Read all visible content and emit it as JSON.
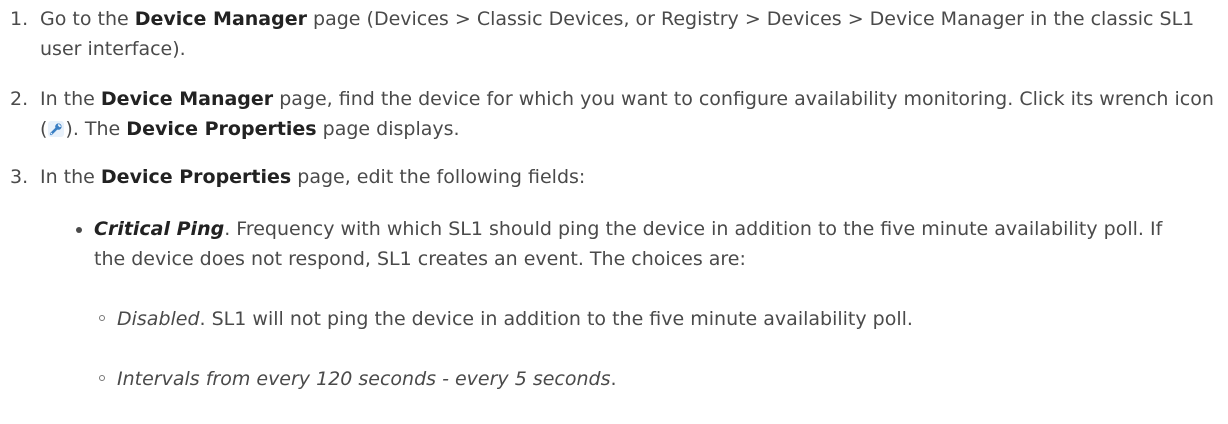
{
  "steps": [
    {
      "number": "1.",
      "pre": "Go to the ",
      "bold1": "Device Manager",
      "post": " page (Devices > Classic Devices, or Registry > Devices > Device Manager in the classic SL1 user interface)."
    },
    {
      "number": "2.",
      "pre": "In the ",
      "bold1": "Device Manager",
      "mid": " page, find the device for which you want to configure availability monitoring. Click its wrench icon (",
      "icon": "wrench-icon",
      "mid2": "). The ",
      "bold2": "Device Properties",
      "post": " page displays."
    },
    {
      "number": "3.",
      "pre": "In the ",
      "bold1": "Device Properties",
      "post": " page, edit the following fields:"
    }
  ],
  "field": {
    "term": "Critical Ping",
    "description": ". Frequency with which SL1 should ping the device in addition to the five minute availability poll. If the device does not respond, SL1 creates an event. The choices are:"
  },
  "choices": [
    {
      "term": "Disabled",
      "description": ". SL1 will not ping the device in addition to the five minute availability poll."
    },
    {
      "term": "Intervals from every 120 seconds - every 5 seconds",
      "description": "."
    }
  ],
  "colors": {
    "text": "#4a4a4a",
    "bold": "#222222",
    "icon": "#3a7fc4"
  }
}
